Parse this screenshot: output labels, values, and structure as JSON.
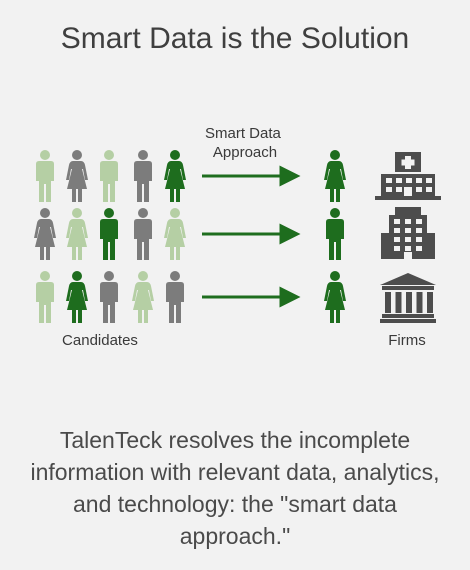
{
  "title": "Smart Data is the Solution",
  "arrow_label": [
    "Smart Data",
    "Approach"
  ],
  "candidates_label": "Candidates",
  "firms_label": "Firms",
  "caption": "TalenTeck resolves the incomplete information with relevant data, analytics, and technology: the \"smart data approach.\"",
  "colors": {
    "dark_green": "#1e6d1e",
    "light_green": "#b5cfa4",
    "gray": "#7c7c7c",
    "building": "#4d4d4d"
  },
  "rows": [
    {
      "candidates": [
        {
          "gender": "male",
          "color": "light_green"
        },
        {
          "gender": "female",
          "color": "gray"
        },
        {
          "gender": "male",
          "color": "light_green"
        },
        {
          "gender": "male",
          "color": "gray"
        },
        {
          "gender": "female",
          "color": "dark_green"
        }
      ],
      "match": {
        "gender": "female",
        "color": "dark_green"
      },
      "firm_icon": "hospital-icon"
    },
    {
      "candidates": [
        {
          "gender": "female",
          "color": "gray"
        },
        {
          "gender": "female",
          "color": "light_green"
        },
        {
          "gender": "male",
          "color": "dark_green"
        },
        {
          "gender": "male",
          "color": "gray"
        },
        {
          "gender": "female",
          "color": "light_green"
        }
      ],
      "match": {
        "gender": "male",
        "color": "dark_green"
      },
      "firm_icon": "office-building-icon"
    },
    {
      "candidates": [
        {
          "gender": "male",
          "color": "light_green"
        },
        {
          "gender": "female",
          "color": "dark_green"
        },
        {
          "gender": "male",
          "color": "gray"
        },
        {
          "gender": "female",
          "color": "light_green"
        },
        {
          "gender": "male",
          "color": "gray"
        }
      ],
      "match": {
        "gender": "female",
        "color": "dark_green"
      },
      "firm_icon": "bank-icon"
    }
  ]
}
